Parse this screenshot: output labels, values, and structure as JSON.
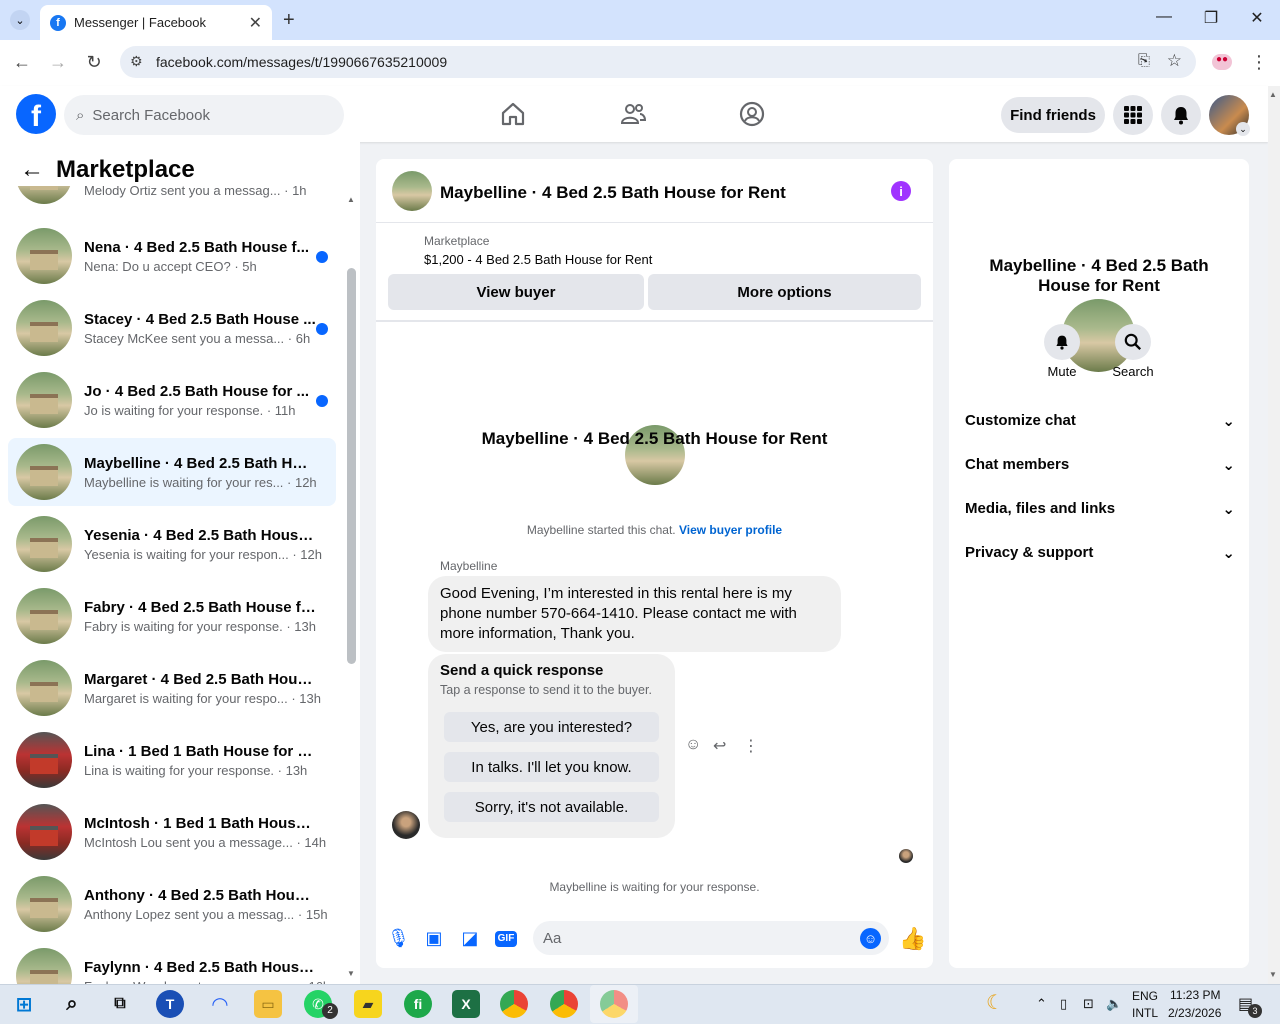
{
  "browser": {
    "tab_title": "Messenger | Facebook",
    "url": "facebook.com/messages/t/1990667635210009"
  },
  "fb": {
    "logo": "f",
    "search_placeholder": "Search Facebook",
    "find_friends": "Find friends"
  },
  "left": {
    "title": "Marketplace",
    "partial_top": "Melody Ortiz sent you a messag... · 1h",
    "conversations": [
      {
        "name": "Nena · 4 Bed 2.5 Bath House f...",
        "preview": "Nena: Do u accept CEO?",
        "time": " · 5h",
        "unread": true
      },
      {
        "name": "Stacey · 4 Bed 2.5 Bath House ...",
        "preview": "Stacey McKee sent you a messa...",
        "time": " · 6h",
        "unread": true
      },
      {
        "name": "Jo · 4 Bed 2.5 Bath House for ...",
        "preview": "Jo is waiting for your response.",
        "time": " · 11h",
        "unread": true
      },
      {
        "name": "Maybelline · 4 Bed 2.5 Bath Hou...",
        "preview": "Maybelline is waiting for your res...",
        "time": " · 12h",
        "unread": false
      },
      {
        "name": "Yesenia · 4 Bed 2.5 Bath House f...",
        "preview": "Yesenia is waiting for your respon...",
        "time": " · 12h",
        "unread": false
      },
      {
        "name": "Fabry · 4 Bed 2.5 Bath House for...",
        "preview": "Fabry is waiting for your response.",
        "time": " · 13h",
        "unread": false
      },
      {
        "name": "Margaret · 4 Bed 2.5 Bath House...",
        "preview": "Margaret is waiting for your respo...",
        "time": " · 13h",
        "unread": false
      },
      {
        "name": "Lina · 1 Bed 1 Bath House for Rent",
        "preview": "Lina is waiting for your response.",
        "time": " · 13h",
        "unread": false
      },
      {
        "name": "McIntosh · 1 Bed 1 Bath House f...",
        "preview": "McIntosh Lou sent you a message...",
        "time": " · 14h",
        "unread": false
      },
      {
        "name": "Anthony · 4 Bed 2.5 Bath House ...",
        "preview": "Anthony Lopez sent you a messag...",
        "time": " · 15h",
        "unread": false
      },
      {
        "name": "Faylynn · 4 Bed 2.5 Bath House f...",
        "preview": "Faylynn Woods sent you a messag...",
        "time": " · 16h",
        "unread": false
      }
    ]
  },
  "chat": {
    "header_title": "Maybelline · 4 Bed 2.5 Bath House for Rent",
    "marketplace_label": "Marketplace",
    "listing": "$1,200 - 4 Bed 2.5 Bath House for Rent",
    "view_buyer": "View buyer",
    "more_options": "More options",
    "center_name": "Maybelline · 4 Bed 2.5 Bath House for Rent",
    "started_text": "Maybelline started this chat. ",
    "view_buyer_profile": "View buyer profile",
    "sender": "Maybelline",
    "message": "Good Evening, I’m interested in this rental here is my phone number 570-664-1410. Please contact me with more information, Thank you.",
    "quick_title": "Send a quick response",
    "quick_sub": "Tap a response to send it to the buyer.",
    "quick_replies": [
      "Yes, are you interested?",
      "In talks. I'll let you know.",
      "Sorry, it's not available."
    ],
    "waiting": "Maybelline is waiting for your response.",
    "composer_placeholder": "Aa"
  },
  "right": {
    "title": "Maybelline · 4 Bed 2.5 Bath House for Rent",
    "mute": "Mute",
    "search": "Search",
    "sections": [
      "Customize chat",
      "Chat members",
      "Media, files and links",
      "Privacy & support"
    ]
  },
  "taskbar": {
    "lang1": "ENG",
    "lang2": "INTL",
    "time": "11:23 PM",
    "date": "2/23/2026",
    "whatsapp_badge": "2",
    "notif_badge": "3"
  }
}
